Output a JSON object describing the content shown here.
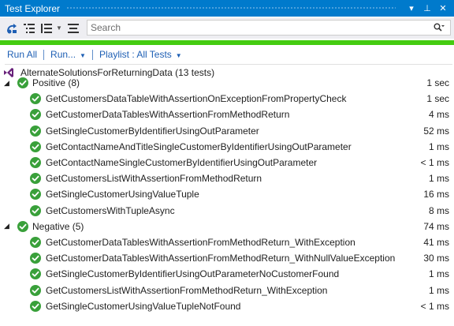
{
  "window": {
    "title": "Test Explorer",
    "dropdown_glyph": "▾",
    "pin_glyph": "⊥",
    "close_glyph": "✕"
  },
  "toolbar": {
    "icons": [
      "run-tests-icon",
      "group-by-icon",
      "playlist-icon",
      "expand-collapse-icon"
    ],
    "search_placeholder": "Search",
    "search_icon": "🔍"
  },
  "status": {
    "color": "#44cc11"
  },
  "commands": {
    "run_all": "Run All",
    "run": "Run...",
    "playlist": "Playlist : All Tests"
  },
  "summary": {
    "label": "AlternateSolutionsForReturningData (13 tests)"
  },
  "groups": [
    {
      "name": "Positive (8)",
      "duration": "1 sec",
      "tests": [
        {
          "name": "GetCustomersDataTableWithAssertionOnExceptionFromPropertyCheck",
          "duration": "1 sec"
        },
        {
          "name": "GetCustomerDataTablesWithAssertionFromMethodReturn",
          "duration": "4 ms"
        },
        {
          "name": "GetSingleCustomerByIdentifierUsingOutParameter",
          "duration": "52 ms"
        },
        {
          "name": "GetContactNameAndTitleSingleCustomerByIdentifierUsingOutParameter",
          "duration": "1 ms"
        },
        {
          "name": "GetContactNameSingleCustomerByIdentifierUsingOutParameter",
          "duration": "< 1 ms"
        },
        {
          "name": "GetCustomersListWithAssertionFromMethodReturn",
          "duration": "1 ms"
        },
        {
          "name": "GetSingleCustomerUsingValueTuple",
          "duration": "16 ms"
        },
        {
          "name": "GetCustomersWithTupleAsync",
          "duration": "8 ms"
        }
      ]
    },
    {
      "name": "Negative (5)",
      "duration": "74 ms",
      "tests": [
        {
          "name": "GetCustomerDataTablesWithAssertionFromMethodReturn_WithException",
          "duration": "41 ms"
        },
        {
          "name": "GetCustomerDataTablesWithAssertionFromMethodReturn_WithNullValueException",
          "duration": "30 ms"
        },
        {
          "name": "GetSingleCustomerByIdentifierUsingOutParameterNoCustomerFound",
          "duration": "1 ms"
        },
        {
          "name": "GetCustomersListWithAssertionFromMethodReturn_WithException",
          "duration": "1 ms"
        },
        {
          "name": "GetSingleCustomerUsingValueTupleNotFound",
          "duration": "< 1 ms"
        }
      ]
    }
  ]
}
